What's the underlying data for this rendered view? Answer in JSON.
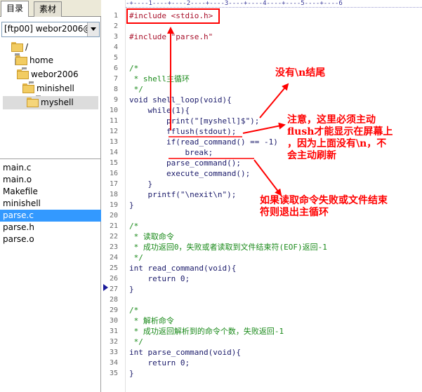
{
  "tabs": [
    {
      "label": "目录",
      "active": true
    },
    {
      "label": "素材",
      "active": false
    }
  ],
  "site_select": {
    "value": "[ftp00] webor2006@"
  },
  "tree": [
    {
      "label": "/"
    },
    {
      "label": "home"
    },
    {
      "label": "webor2006"
    },
    {
      "label": "minishell"
    },
    {
      "label": "myshell"
    }
  ],
  "files": [
    {
      "label": "main.c"
    },
    {
      "label": "main.o"
    },
    {
      "label": "Makefile"
    },
    {
      "label": "minishell"
    },
    {
      "label": "parse.c"
    },
    {
      "label": "parse.h"
    },
    {
      "label": "parse.o"
    }
  ],
  "editor": {
    "ruler": "-+----1----+----2----+----3----+----4----+----5----+----6",
    "lines": [
      {
        "n": "1",
        "text": "#include <stdio.h>"
      },
      {
        "n": "2",
        "text": ""
      },
      {
        "n": "3",
        "text": "#include \"parse.h\""
      },
      {
        "n": "4",
        "text": ""
      },
      {
        "n": "5",
        "text": ""
      },
      {
        "n": "6",
        "text": "/*"
      },
      {
        "n": "7",
        "text": " * shell主循环"
      },
      {
        "n": "8",
        "text": " */"
      },
      {
        "n": "9",
        "text": "void shell_loop(void){"
      },
      {
        "n": "10",
        "text": "    while(1){"
      },
      {
        "n": "11",
        "text": "        print(\"[myshell]$\");"
      },
      {
        "n": "12",
        "text": "        fflush(stdout);"
      },
      {
        "n": "13",
        "text": "        if(read_command() == -1)"
      },
      {
        "n": "14",
        "text": "            break;"
      },
      {
        "n": "15",
        "text": "        parse_command();"
      },
      {
        "n": "16",
        "text": "        execute_command();"
      },
      {
        "n": "17",
        "text": "    }"
      },
      {
        "n": "18",
        "text": "    printf(\"\\nexit\\n\");"
      },
      {
        "n": "19",
        "text": "}"
      },
      {
        "n": "20",
        "text": ""
      },
      {
        "n": "21",
        "text": "/*"
      },
      {
        "n": "22",
        "text": " * 读取命令"
      },
      {
        "n": "23",
        "text": " * 成功返回0，失败或者读取到文件结束符(EOF)返回-1"
      },
      {
        "n": "24",
        "text": " */"
      },
      {
        "n": "25",
        "text": "int read_command(void){"
      },
      {
        "n": "26",
        "text": "    return 0;"
      },
      {
        "n": "27",
        "text": "}"
      },
      {
        "n": "28",
        "text": ""
      },
      {
        "n": "29",
        "text": "/*"
      },
      {
        "n": "30",
        "text": " * 解析命令"
      },
      {
        "n": "31",
        "text": " * 成功返回解析到的命令个数，失败返回-1"
      },
      {
        "n": "32",
        "text": " */"
      },
      {
        "n": "33",
        "text": "int parse_command(void){"
      },
      {
        "n": "34",
        "text": "    return 0;"
      },
      {
        "n": "35",
        "text": "}"
      }
    ]
  },
  "annotations": {
    "no_newline": "没有\\n结尾",
    "fflush_note_1": "注意，这里必须主动",
    "fflush_note_2": "flush才能显示在屏幕上",
    "fflush_note_3": "，因为上面没有\\n，不",
    "fflush_note_4": "会主动刷新",
    "read_fail_1": "如果读取命令失败或文件结束",
    "read_fail_2": "符则退出主循环"
  },
  "colors": {
    "annotation": "#ff0000",
    "selected_file": "#3399ff"
  }
}
